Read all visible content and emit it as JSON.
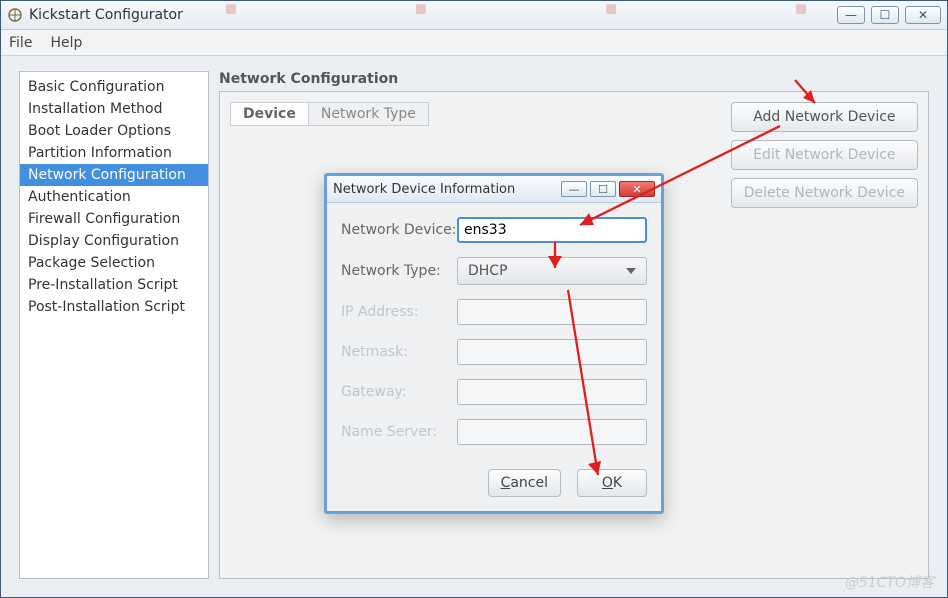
{
  "window": {
    "title": "Kickstart Configurator",
    "controls": {
      "min": "—",
      "max": "☐",
      "close": "✕"
    }
  },
  "menubar": {
    "file": "File",
    "help": "Help"
  },
  "sidebar": {
    "items": [
      "Basic Configuration",
      "Installation Method",
      "Boot Loader Options",
      "Partition Information",
      "Network Configuration",
      "Authentication",
      "Firewall Configuration",
      "Display Configuration",
      "Package Selection",
      "Pre-Installation Script",
      "Post-Installation Script"
    ],
    "selected_index": 4
  },
  "section": {
    "title": "Network Configuration",
    "tabs": {
      "device": "Device",
      "network_type": "Network Type"
    }
  },
  "buttons": {
    "add": "Add Network Device",
    "edit": "Edit Network Device",
    "delete": "Delete Network Device"
  },
  "dialog": {
    "title": "Network Device Information",
    "controls": {
      "min": "—",
      "max": "☐",
      "close": "✕"
    },
    "fields": {
      "network_device": {
        "label": "Network Device:",
        "value": "ens33"
      },
      "network_type": {
        "label": "Network Type:",
        "value": "DHCP"
      },
      "ip_address": {
        "label": "IP Address:",
        "value": ""
      },
      "netmask": {
        "label": "Netmask:",
        "value": ""
      },
      "gateway": {
        "label": "Gateway:",
        "value": ""
      },
      "name_server": {
        "label": "Name Server:",
        "value": ""
      }
    },
    "buttons": {
      "cancel_u": "C",
      "cancel_rest": "ancel",
      "ok_u": "O",
      "ok_rest": "K"
    }
  },
  "watermark": "@51CTO博客"
}
